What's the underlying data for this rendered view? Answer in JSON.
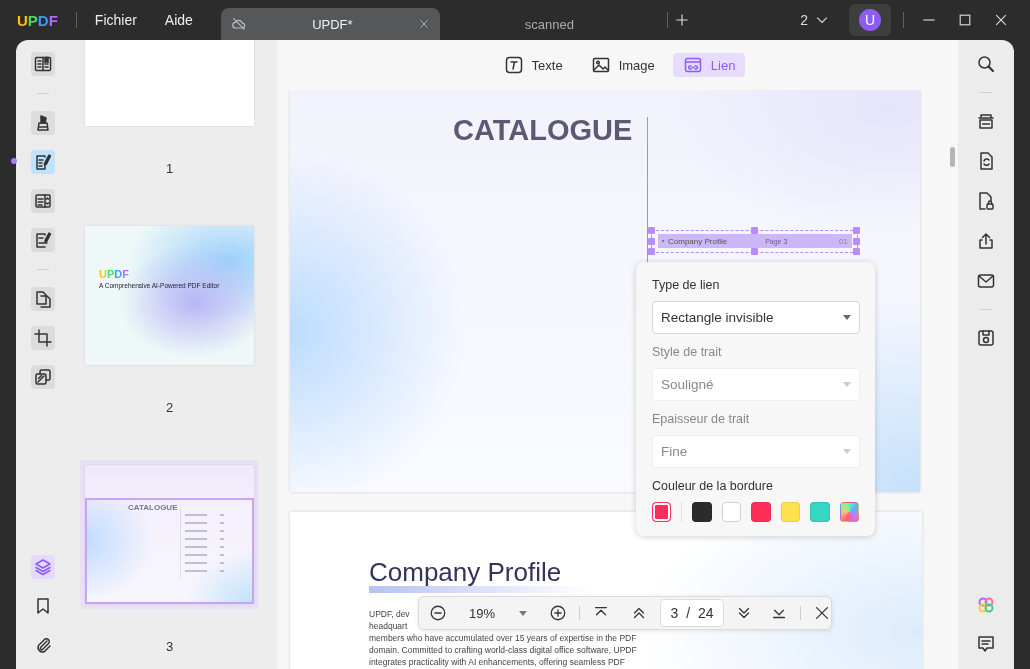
{
  "titlebar": {
    "logo": "UPDF",
    "menu": [
      "Fichier",
      "Aide"
    ],
    "tabs": [
      {
        "label": "UPDF*",
        "selected": true
      },
      {
        "label": "scanned",
        "selected": false
      }
    ],
    "window_count": "2",
    "avatar": "U"
  },
  "left_tools": {
    "groups": [
      {
        "items": [
          {
            "kind": "reader",
            "selected": false
          }
        ]
      },
      {
        "items": [
          {
            "kind": "comment",
            "selected": false
          },
          {
            "kind": "edit",
            "selected": true
          },
          {
            "kind": "form",
            "selected": false
          },
          {
            "kind": "sign",
            "selected": false
          }
        ]
      },
      {
        "items": [
          {
            "kind": "pages",
            "selected": false
          },
          {
            "kind": "crop",
            "selected": false
          },
          {
            "kind": "overlay",
            "selected": false
          }
        ]
      }
    ],
    "bottom": [
      {
        "kind": "layers",
        "selected": true
      },
      {
        "kind": "bookmark",
        "selected": false
      },
      {
        "kind": "attachment",
        "selected": false
      }
    ]
  },
  "thumbnails": [
    {
      "kind": "blank",
      "page": "1",
      "selected": false
    },
    {
      "kind": "cover",
      "page": "2",
      "title": "UPDF",
      "subtitle": "A Comprehensive AI-Powered PDF Editor",
      "selected": false
    },
    {
      "kind": "catalogue",
      "page": "3",
      "title": "CATALOGUE",
      "selected": true
    }
  ],
  "edit_toolbar": [
    {
      "kind": "text",
      "label": "Texte",
      "selected": false
    },
    {
      "kind": "image",
      "label": "Image",
      "selected": false
    },
    {
      "kind": "link",
      "label": "Lien",
      "selected": true
    }
  ],
  "page_1": {
    "title": "CATALOGUE",
    "link": {
      "label": "Company Profile",
      "target": "Page 3",
      "number": "01"
    }
  },
  "page_2": {
    "title": "Company Profile",
    "lines": [
      "UPDF, dev",
      "headquart",
      "members who have accumulated over 15 years of expertise in the PDF",
      "domain. Committed to crafting world-class digital office software, UPDF",
      "integrates practicality with AI enhancements, offering seamless PDF"
    ]
  },
  "link_panel": {
    "fields": [
      {
        "label": "Type de lien",
        "value": "Rectangle invisible",
        "disabled": false
      },
      {
        "label": "Style de trait",
        "value": "Souligné",
        "disabled": true
      },
      {
        "label": "Epaisseur de trait",
        "value": "Fine",
        "disabled": true
      }
    ],
    "color_label": "Couleur de la bordure",
    "swatches": [
      {
        "kind": "current",
        "color": "#ff2d5a"
      },
      {
        "kind": "solid",
        "color": "#2b2b2b"
      },
      {
        "kind": "solid",
        "color": "#ffffff"
      },
      {
        "kind": "solid",
        "color": "#ff2d5a"
      },
      {
        "kind": "solid",
        "color": "#ffe14d"
      },
      {
        "kind": "solid",
        "color": "#36d6c2"
      },
      {
        "kind": "gradient"
      }
    ]
  },
  "zoom_bar": {
    "zoom": "19%",
    "page": "3",
    "separator": "/",
    "total": "24"
  },
  "right_tools": {
    "groups": [
      {
        "items": [
          {
            "kind": "search"
          }
        ]
      },
      {
        "items": [
          {
            "kind": "ocr"
          },
          {
            "kind": "convert"
          },
          {
            "kind": "protect"
          },
          {
            "kind": "share"
          },
          {
            "kind": "email"
          }
        ]
      },
      {
        "items": [
          {
            "kind": "save"
          }
        ]
      }
    ],
    "bottom": [
      {
        "kind": "ai"
      },
      {
        "kind": "comment"
      }
    ]
  }
}
